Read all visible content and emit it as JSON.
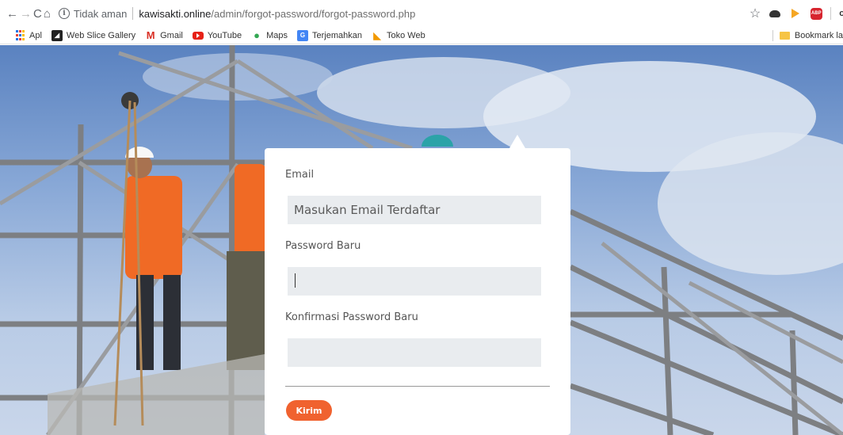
{
  "browser": {
    "nav": {
      "back": "←",
      "forward": "→",
      "reload": "C",
      "home": "⌂"
    },
    "security_label": "Tidak aman",
    "url_host": "kawisakti.online",
    "url_path": "/admin/forgot-password/forgot-password.php",
    "extensions": [
      "star-icon",
      "cloud-icon",
      "play-icon",
      "abp-icon",
      "key-icon",
      "avatar"
    ],
    "abp_label": "ABP",
    "key_label": "o-"
  },
  "bookmarks": {
    "items": [
      {
        "label": "Apl",
        "icon": "apps-icon"
      },
      {
        "label": "Web Slice Gallery",
        "icon": "webslice-icon"
      },
      {
        "label": "Gmail",
        "icon": "gmail-icon"
      },
      {
        "label": "YouTube",
        "icon": "youtube-icon"
      },
      {
        "label": "Maps",
        "icon": "maps-icon"
      },
      {
        "label": "Terjemahkan",
        "icon": "translate-icon"
      },
      {
        "label": "Toko Web",
        "icon": "webstore-icon"
      }
    ],
    "other": "Bookmark la"
  },
  "form": {
    "email_label": "Email",
    "email_placeholder": "Masukan Email Terdaftar",
    "new_password_label": "Password Baru",
    "new_password_value": "",
    "confirm_password_label": "Konfirmasi Password Baru",
    "confirm_password_value": "",
    "submit_label": "Kirim"
  },
  "colors": {
    "accent": "#f0622f",
    "input_bg": "#e9ecef",
    "sky_top": "#5a82c0",
    "sky_bottom": "#c9d6ea"
  }
}
